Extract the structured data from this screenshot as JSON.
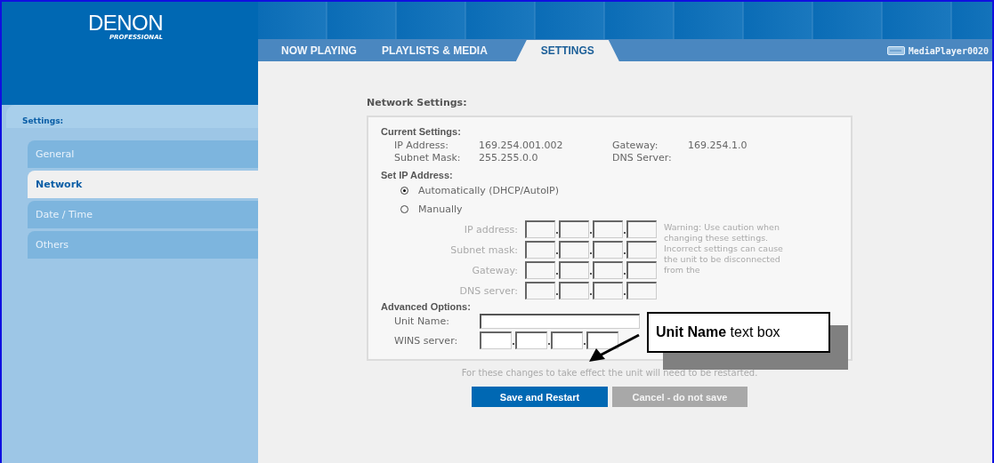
{
  "brand": {
    "name": "DENON",
    "sub": "PROFESSIONAL"
  },
  "tabs": [
    {
      "label": "NOW PLAYING",
      "selected": false
    },
    {
      "label": "PLAYLISTS & MEDIA",
      "selected": false
    },
    {
      "label": "SETTINGS",
      "selected": true
    }
  ],
  "device": "MediaPlayer0020",
  "sidebar": {
    "title": "Settings:",
    "items": [
      {
        "label": "General",
        "selected": false
      },
      {
        "label": "Network",
        "selected": true
      },
      {
        "label": "Date / Time",
        "selected": false
      },
      {
        "label": "Others",
        "selected": false
      }
    ]
  },
  "page_title": "Network Settings:",
  "current": {
    "heading": "Current Settings:",
    "items": [
      {
        "label": "IP Address:",
        "value": "169.254.001.002"
      },
      {
        "label": "Gateway:",
        "value": "169.254.1.0"
      },
      {
        "label": "Subnet Mask:",
        "value": "255.255.0.0"
      },
      {
        "label": "DNS Server:"
      }
    ]
  },
  "set_ip": {
    "heading": "Set IP Address:",
    "options": [
      {
        "label": "Automatically (DHCP/AutoIP)",
        "selected": true
      },
      {
        "label": "Manually",
        "selected": false
      }
    ]
  },
  "manual": {
    "disabled": true,
    "fields": [
      {
        "label": "IP address:"
      },
      {
        "label": "Subnet mask:"
      },
      {
        "label": "Gateway:"
      },
      {
        "label": "DNS server:"
      }
    ],
    "warning": "Warning: Use caution when changing these settings. Incorrect settings can cause the unit to be disconnected from the"
  },
  "advanced": {
    "heading": "Advanced Options:",
    "unit_name_label": "Unit Name:",
    "wins_label": "WINS server:"
  },
  "note": "For these changes to take effect the unit will need to be restarted.",
  "buttons": [
    {
      "label": "Save and Restart",
      "kind": "primary"
    },
    {
      "label": "Cancel - do not save",
      "kind": "secondary"
    }
  ],
  "callout": {
    "text": "**Unit Name** text box"
  }
}
